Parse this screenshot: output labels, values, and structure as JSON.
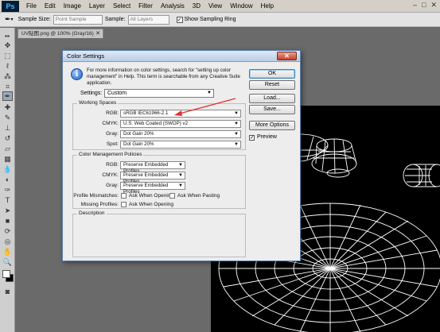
{
  "app": {
    "logo": "Ps",
    "menu": [
      "File",
      "Edit",
      "Image",
      "Layer",
      "Select",
      "Filter",
      "Analysis",
      "3D",
      "View",
      "Window",
      "Help"
    ],
    "window_controls": [
      "–",
      "□",
      "✕"
    ]
  },
  "options_bar": {
    "sample_size_label": "Sample Size:",
    "sample_size_value": "Point Sample",
    "sample_label": "Sample:",
    "sample_value": "All Layers",
    "show_ring_label": "Show Sampling Ring",
    "show_ring_checked": "✓"
  },
  "document": {
    "tab_title": "UV贴图.png @ 100% (Gray/16)",
    "tab_close": "✕"
  },
  "dialog": {
    "title": "Color Settings",
    "close": "✕",
    "info_icon_glyph": "i",
    "info_text": "For more information on color settings, search for \"setting up color management\" in Help. This term is searchable from any Creative Suite application.",
    "settings_label": "Settings:",
    "settings_value": "Custom",
    "working_spaces": {
      "title": "Working Spaces",
      "rows": [
        {
          "label": "RGB:",
          "value": "sRGB IEC61966-2.1"
        },
        {
          "label": "CMYK:",
          "value": "U.S. Web Coated (SWOP) v2"
        },
        {
          "label": "Gray:",
          "value": "Dot Gain 20%"
        },
        {
          "label": "Spot:",
          "value": "Dot Gain 20%"
        }
      ]
    },
    "policies": {
      "title": "Color Management Policies",
      "rows": [
        {
          "label": "RGB:",
          "value": "Preserve Embedded Profiles"
        },
        {
          "label": "CMYK:",
          "value": "Preserve Embedded Profiles"
        },
        {
          "label": "Gray:",
          "value": "Preserve Embedded Profiles"
        }
      ],
      "profile_mismatches_label": "Profile Mismatches:",
      "ask_when_opening": "Ask When Opening",
      "ask_when_pasting": "Ask When Pasting",
      "missing_profiles_label": "Missing Profiles:",
      "missing_ask_when_opening": "Ask When Opening"
    },
    "description_title": "Description",
    "buttons": {
      "ok": "OK",
      "reset": "Reset",
      "load": "Load...",
      "save": "Save...",
      "more_options": "More Options"
    },
    "preview_label": "Preview",
    "preview_checked": "✓"
  },
  "colors": {
    "annotation_arrow": "#e03030",
    "dialog_border": "#5b7fb0",
    "canvas_background": "#000000",
    "wireframe": "#ffffff"
  }
}
